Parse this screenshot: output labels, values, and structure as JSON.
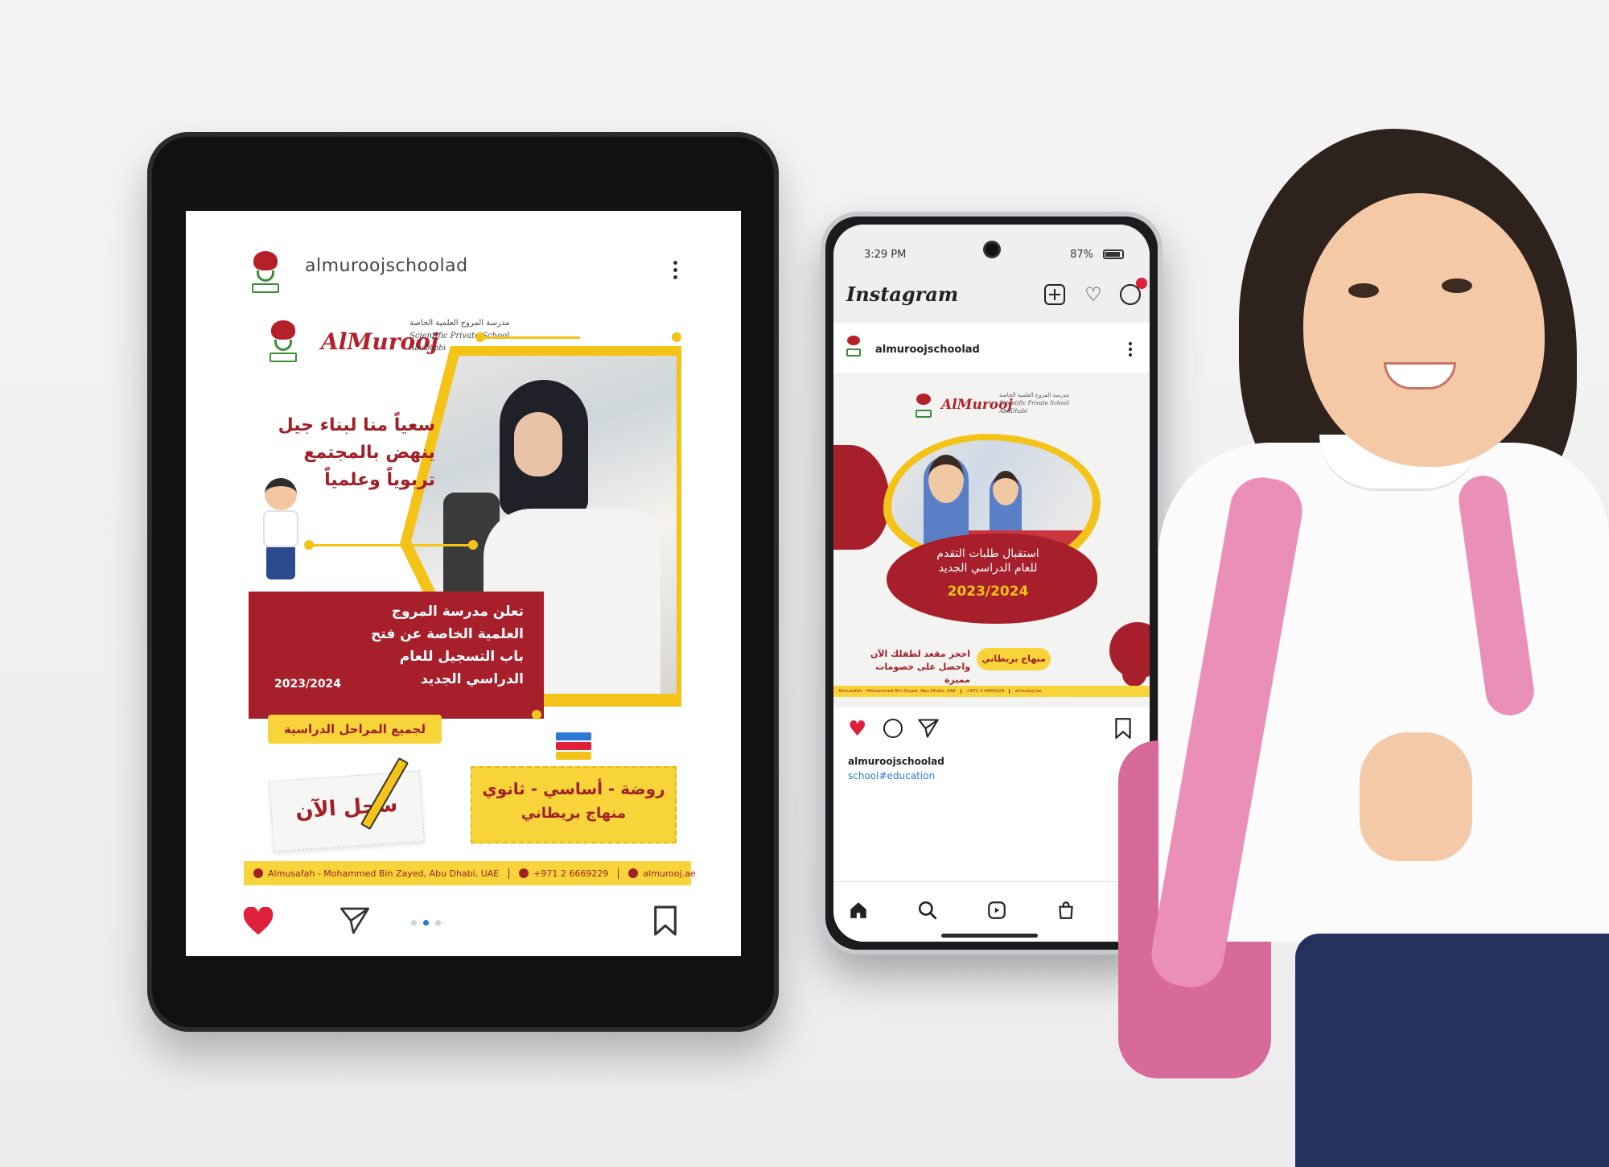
{
  "tablet": {
    "username": "almuroojschoolad",
    "brand_name": "AlMurooj",
    "brand_arabic": "مدرسة المروج العلمية الخاصة",
    "brand_english": "Scientific Private School",
    "brand_city": "AbuDhabi",
    "slogan_l1": "سعياً منا لبناء جيل",
    "slogan_l2": "ينهض بالمجتمع",
    "slogan_l3": "تربوياً وعلمياً",
    "band_l1": "تعلن مدرسة المروج",
    "band_l2": "العلمية الخاصة عن فتح",
    "band_l3": "باب التسجيل للعام",
    "band_l4": "الدراسي الجديد",
    "band_year": "2023/2024",
    "stages_pill": "لجميع المراحل الدراسية",
    "register_now": "سجل الآن",
    "levels": "روضة - أساسي - ثانوي",
    "curriculum": "منهاج بريطاني",
    "footer": {
      "address": "Almusafah - Mohammed Bin Zayed, Abu Dhabi, UAE",
      "phone": "+971 2 6669229",
      "website": "almurooj.ae"
    },
    "carousel_active_index": 1,
    "icons": [
      "heart-icon",
      "send-icon",
      "bookmark-icon",
      "more-icon"
    ]
  },
  "phone": {
    "status_time": "3:29 PM",
    "battery": "87%",
    "app_title": "Instagram",
    "username": "almuroojschoolad",
    "post": {
      "brand_name": "AlMurooj",
      "brand_arabic": "مدرسة المروج العلمية الخاصة",
      "brand_english": "Scientific Private School",
      "brand_city": "AbuDhabi",
      "blob_l1": "استقبال طلبات التقدم",
      "blob_l2": "للعام الدراسي الجديد",
      "blob_year": "2023/2024",
      "curriculum_pill": "منهاج بريطاني",
      "offer_l1": "احجز مقعد لطفلك الآن",
      "offer_l2": "واحصل على خصومات مميزة",
      "footer_address": "Almusafah - Mohammed Bin Zayed, Abu Dhabi, UAE",
      "footer_phone": "+971 2 6669229",
      "footer_website": "almurooj.ae"
    },
    "caption_user": "almuroojschoolad",
    "caption_tag": "school#education",
    "icons": [
      "new-post-icon",
      "heart-icon",
      "messenger-icon",
      "comment-icon",
      "send-icon",
      "bookmark-icon",
      "home-icon",
      "search-icon",
      "reels-icon",
      "shop-icon",
      "profile-icon"
    ]
  },
  "colors": {
    "brand_red": "#a71f2a",
    "brand_yellow": "#f6d43a",
    "like_red": "#e0203a",
    "link_blue": "#2a7ad6"
  }
}
